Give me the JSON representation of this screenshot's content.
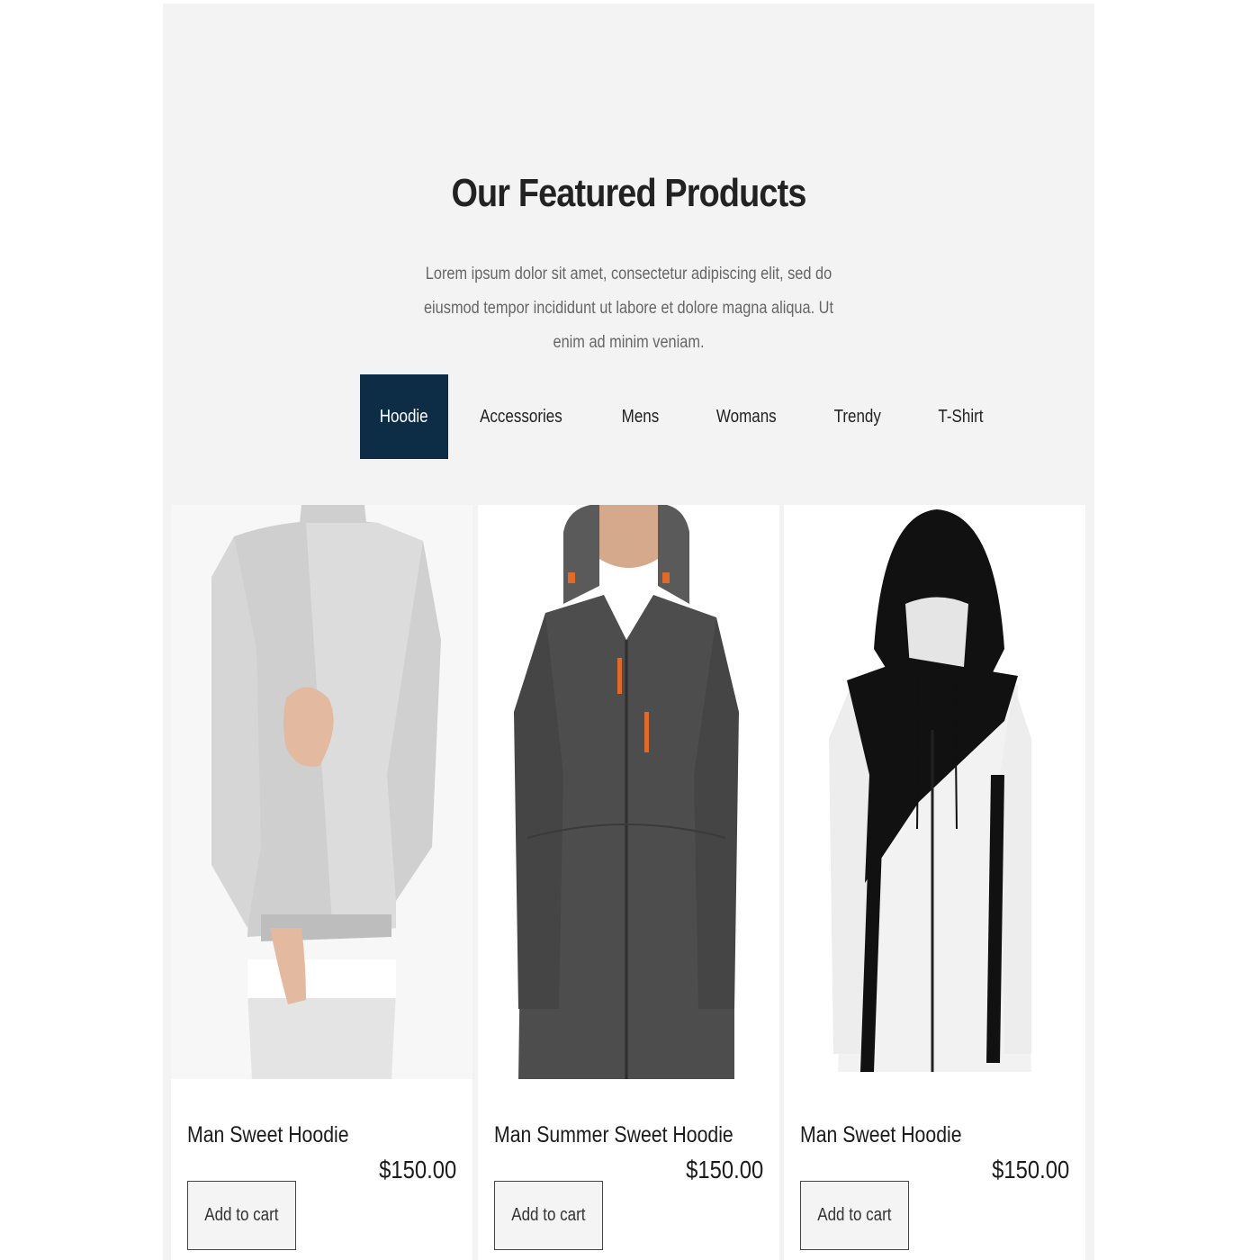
{
  "section": {
    "title": "Our Featured Products",
    "description": "Lorem ipsum dolor sit amet, consectetur adipiscing elit, sed do eiusmod tempor incididunt ut labore et dolore magna aliqua. Ut enim ad minim veniam."
  },
  "tabs": [
    {
      "label": "Hoodie",
      "active": true
    },
    {
      "label": "Accessories",
      "active": false
    },
    {
      "label": "Mens",
      "active": false
    },
    {
      "label": "Womans",
      "active": false
    },
    {
      "label": "Trendy",
      "active": false
    },
    {
      "label": "T-Shirt",
      "active": false
    }
  ],
  "products": [
    {
      "name": "Man Sweet Hoodie",
      "price": "$150.00",
      "button": "Add to cart",
      "image": "grey-sweatshirt"
    },
    {
      "name": "Man Summer Sweet Hoodie",
      "price": "$150.00",
      "button": "Add to cart",
      "image": "dark-grey-zip-hoodie"
    },
    {
      "name": "Man Sweet Hoodie",
      "price": "$150.00",
      "button": "Add to cart",
      "image": "black-white-zip-hoodie"
    }
  ],
  "colors": {
    "section_bg": "#f3f3f3",
    "active_tab_bg": "#0d2d46",
    "active_tab_text": "#ffffff"
  }
}
